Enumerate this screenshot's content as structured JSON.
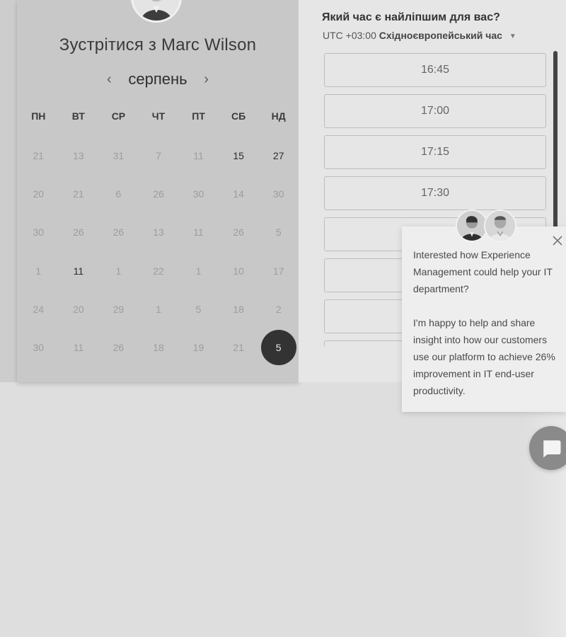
{
  "scheduler": {
    "title": "Зустрітися з Marc Wilson",
    "month": "серпень",
    "prev_label": "‹",
    "next_label": "›",
    "weekdays": [
      "ПН",
      "ВТ",
      "СР",
      "ЧТ",
      "ПТ",
      "СБ",
      "НД"
    ],
    "days": [
      [
        {
          "d": "21",
          "s": "disabled"
        },
        {
          "d": "13",
          "s": "disabled"
        },
        {
          "d": "31",
          "s": "disabled"
        },
        {
          "d": "7",
          "s": "disabled"
        },
        {
          "d": "11",
          "s": "disabled"
        },
        {
          "d": "15",
          "s": "available"
        },
        {
          "d": "27",
          "s": "available"
        }
      ],
      [
        {
          "d": "20",
          "s": "disabled"
        },
        {
          "d": "21",
          "s": "disabled"
        },
        {
          "d": "6",
          "s": "disabled"
        },
        {
          "d": "26",
          "s": "disabled"
        },
        {
          "d": "30",
          "s": "disabled"
        },
        {
          "d": "14",
          "s": "disabled"
        },
        {
          "d": "30",
          "s": "disabled"
        }
      ],
      [
        {
          "d": "30",
          "s": "disabled"
        },
        {
          "d": "26",
          "s": "disabled"
        },
        {
          "d": "26",
          "s": "disabled"
        },
        {
          "d": "13",
          "s": "disabled"
        },
        {
          "d": "11",
          "s": "disabled"
        },
        {
          "d": "26",
          "s": "disabled"
        },
        {
          "d": "5",
          "s": "disabled"
        }
      ],
      [
        {
          "d": "1",
          "s": "disabled"
        },
        {
          "d": "11",
          "s": "available"
        },
        {
          "d": "1",
          "s": "disabled"
        },
        {
          "d": "22",
          "s": "disabled"
        },
        {
          "d": "1",
          "s": "disabled"
        },
        {
          "d": "10",
          "s": "disabled"
        },
        {
          "d": "17",
          "s": "disabled"
        }
      ],
      [
        {
          "d": "24",
          "s": "disabled"
        },
        {
          "d": "20",
          "s": "disabled"
        },
        {
          "d": "29",
          "s": "disabled"
        },
        {
          "d": "1",
          "s": "disabled"
        },
        {
          "d": "5",
          "s": "disabled"
        },
        {
          "d": "18",
          "s": "disabled"
        },
        {
          "d": "2",
          "s": "disabled"
        }
      ],
      [
        {
          "d": "30",
          "s": "disabled"
        },
        {
          "d": "11",
          "s": "disabled"
        },
        {
          "d": "26",
          "s": "disabled"
        },
        {
          "d": "18",
          "s": "disabled"
        },
        {
          "d": "19",
          "s": "disabled"
        },
        {
          "d": "21",
          "s": "disabled"
        },
        {
          "d": "5",
          "s": "selected"
        }
      ]
    ]
  },
  "time": {
    "question": "Який час є найліпшим для вас?",
    "tz_offset": "UTC +03:00",
    "tz_name": "Східноєвропейський час",
    "slots": [
      "16:45",
      "17:00",
      "17:15",
      "17:30",
      "",
      "",
      "",
      ""
    ]
  },
  "chat": {
    "message_1": "Interested how Experience Management could help your IT department?",
    "message_2": "I'm happy to help and share insight into how our customers use our platform to achieve 26% improvement in IT end-user productivity.",
    "close_icon": "close-icon",
    "launcher_icon": "chat-bubble-icon"
  },
  "colors": {
    "selected_day": "#333333",
    "scrollbar": "#444444"
  }
}
